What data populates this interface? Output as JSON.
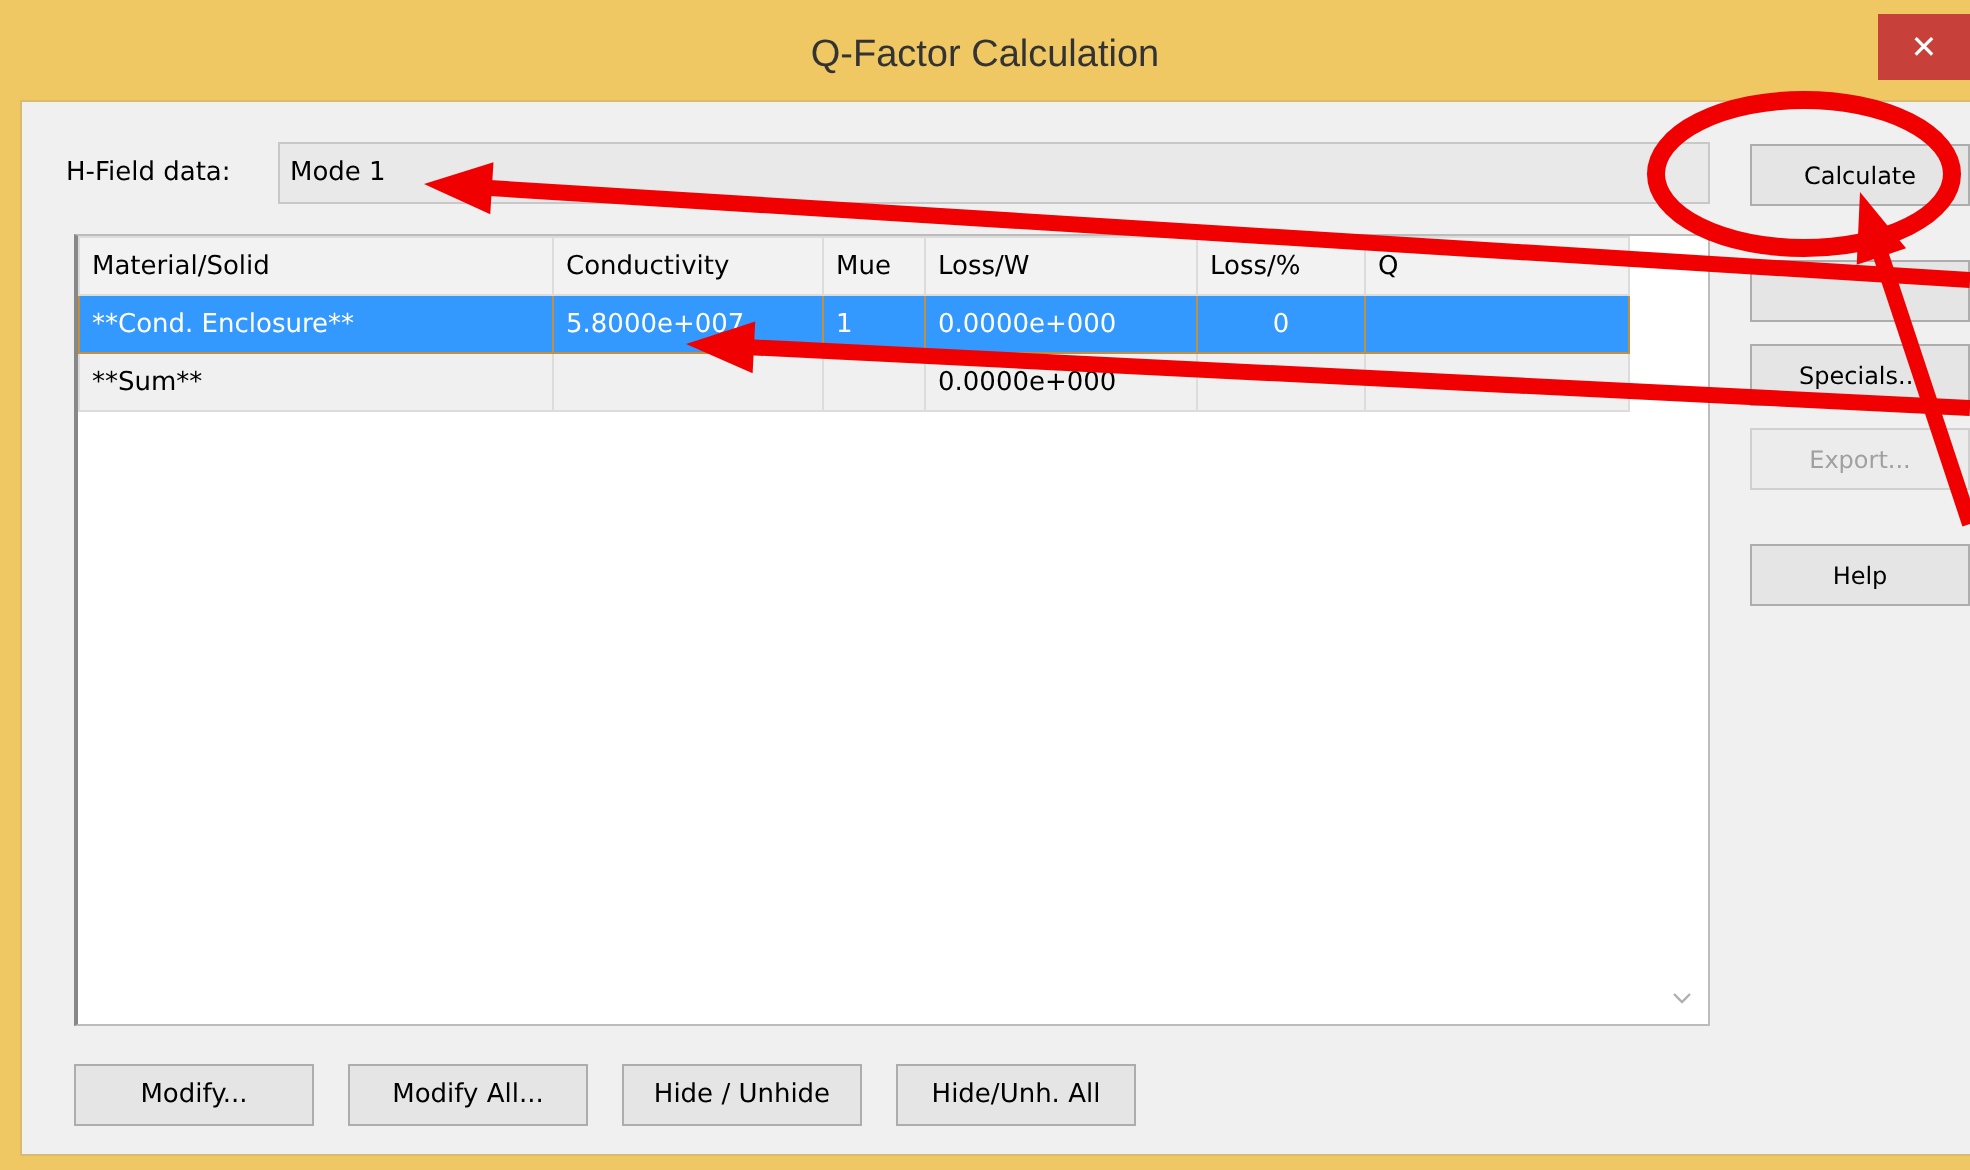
{
  "window": {
    "title": "Q-Factor Calculation",
    "close": "✕"
  },
  "hfield": {
    "label": "H-Field data:",
    "value": "Mode 1"
  },
  "table": {
    "columns": [
      "Material/Solid",
      "Conductivity",
      "Mue",
      "Loss/W",
      "Loss/%",
      "Q"
    ],
    "rows": [
      {
        "cells": [
          "**Cond. Enclosure**",
          "5.8000e+007",
          "1",
          "0.0000e+000",
          "0",
          ""
        ],
        "selected": true
      },
      {
        "cells": [
          "**Sum**",
          "",
          "",
          "0.0000e+000",
          "",
          ""
        ],
        "selected": false
      }
    ]
  },
  "side_buttons": [
    {
      "label": "Calculate",
      "disabled": false
    },
    {
      "disabled": false
    },
    {
      "label": "Specials...",
      "disabled": false
    },
    {
      "label": "Export...",
      "disabled": true
    },
    {
      "label": "Help",
      "disabled": false
    }
  ],
  "bottom_buttons": [
    "Modify...",
    "Modify All...",
    "Hide / Unhide",
    "Hide/Unh. All"
  ],
  "annotations": [
    {
      "kind": "ellipse"
    },
    {
      "kind": "arrow"
    },
    {
      "kind": "arrow"
    },
    {
      "kind": "arrow"
    }
  ]
}
